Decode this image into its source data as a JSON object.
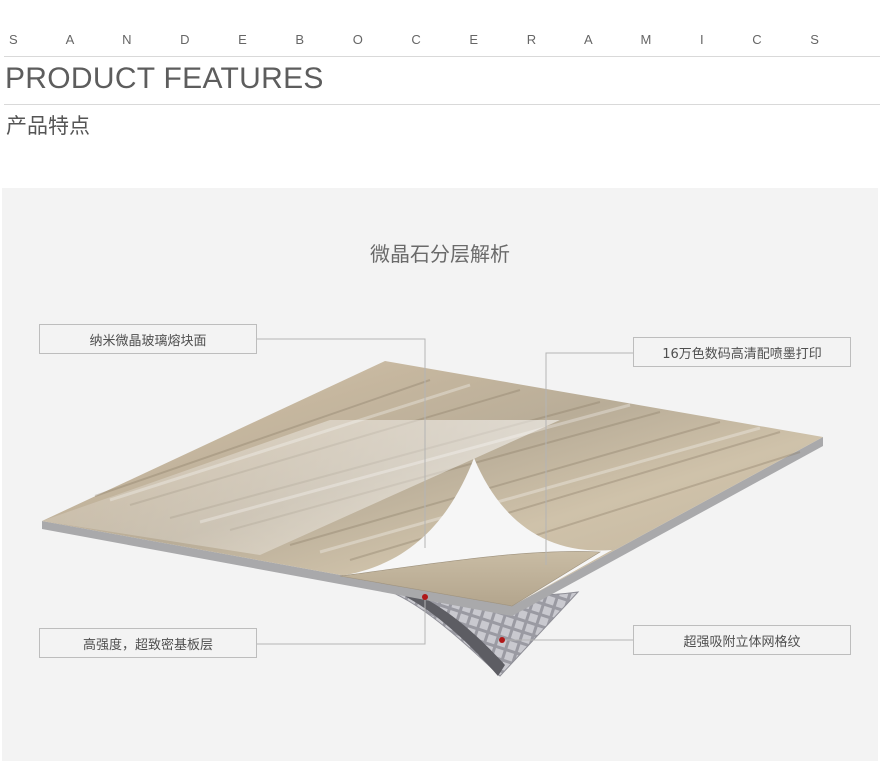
{
  "header": {
    "brand": "S A N D E B O  C E R A M I C S",
    "title_en": "PRODUCT FEATURES",
    "title_cn": "产品特点"
  },
  "diagram": {
    "title": "微晶石分层解析",
    "labels": {
      "top_left": "纳米微晶玻璃熔块面",
      "top_right": "16万色数码高清配喷墨打印",
      "bottom_left": "高强度，超致密基板层",
      "bottom_right": "超强吸附立体网格纹"
    }
  },
  "colors": {
    "panel_bg": "#f3f3f3",
    "text": "#555555",
    "rule": "#d9d9d9",
    "marker": "#b01818"
  }
}
